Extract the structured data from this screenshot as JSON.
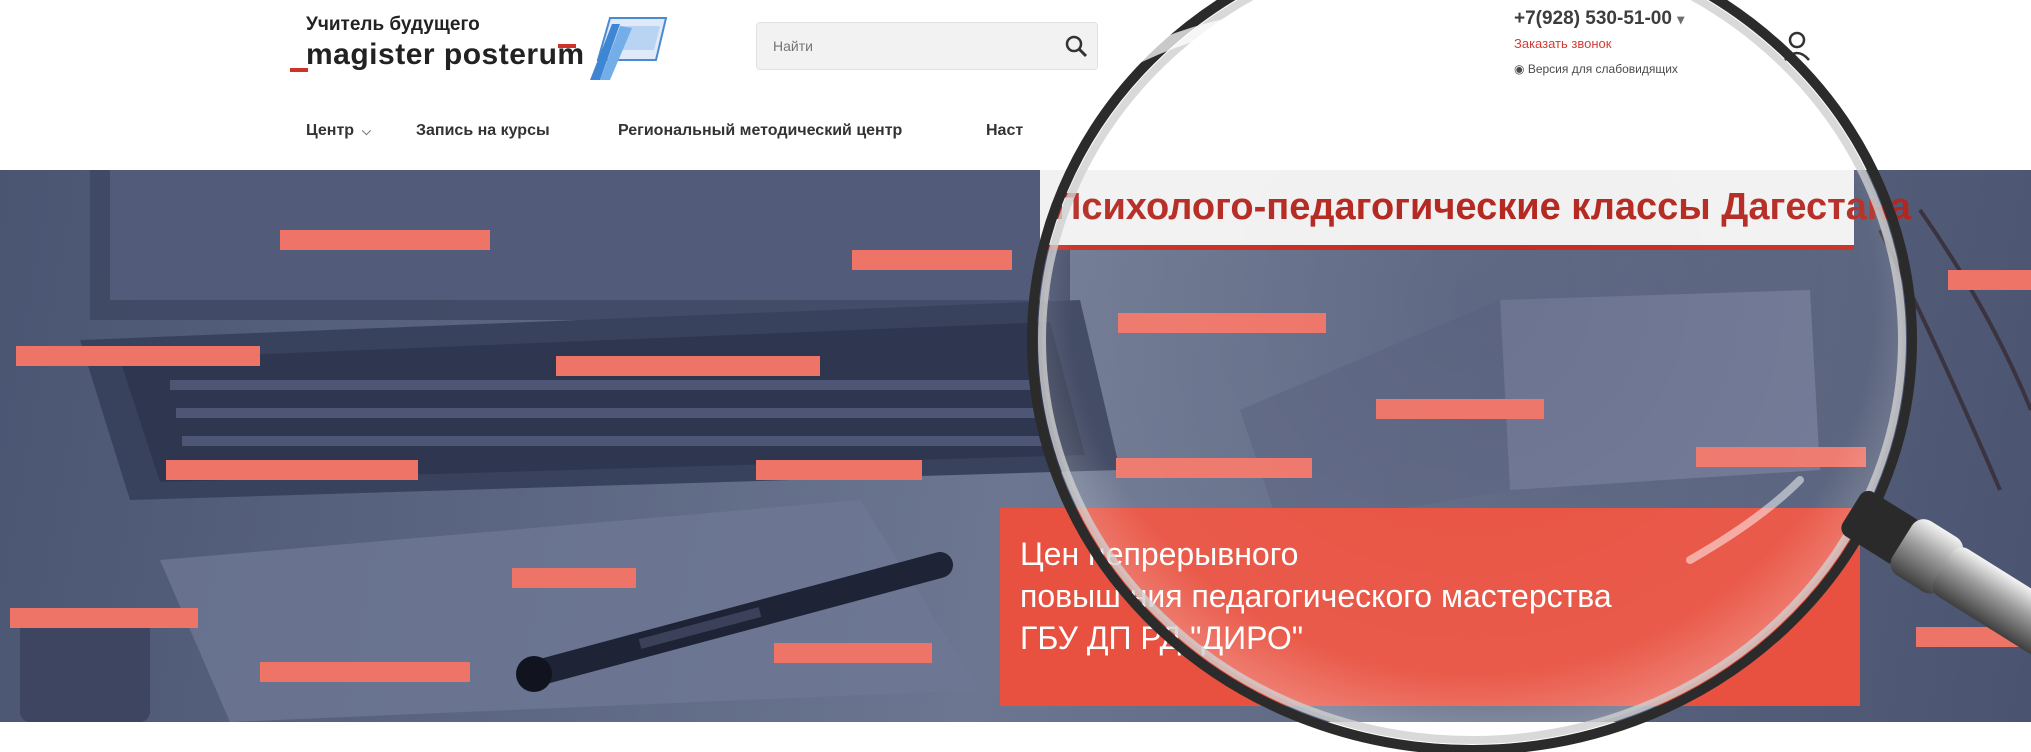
{
  "header": {
    "logo": {
      "tagline": "Учитель будущего",
      "name": "magister posterum"
    },
    "search": {
      "placeholder": "Найти",
      "icon": "search-icon"
    },
    "contact": {
      "phone": "+7(928) 530-51-00",
      "callback_link": "Заказать звонок",
      "vision_link": "Версия для слабовидящих"
    },
    "user_icon": "user-icon",
    "nav": [
      {
        "label": "Центр",
        "dropdown": true
      },
      {
        "label": "Запись на курсы"
      },
      {
        "label": "Региональный методический центр"
      },
      {
        "label": "Наст"
      }
    ]
  },
  "hero": {
    "magnified_heading": "Психолого-педагогические классы Дагестана",
    "banner": {
      "line1": "Цен    непрерывного",
      "line2": "повыш     ния педагогического мастерства",
      "line3": "ГБУ ДП     РД \"ДИРО\""
    }
  },
  "colors": {
    "accent_red": "#d0322a",
    "banner_red": "#e8503f",
    "redaction_bar": "#ee7468",
    "hero_overlay": "#5c6783"
  }
}
